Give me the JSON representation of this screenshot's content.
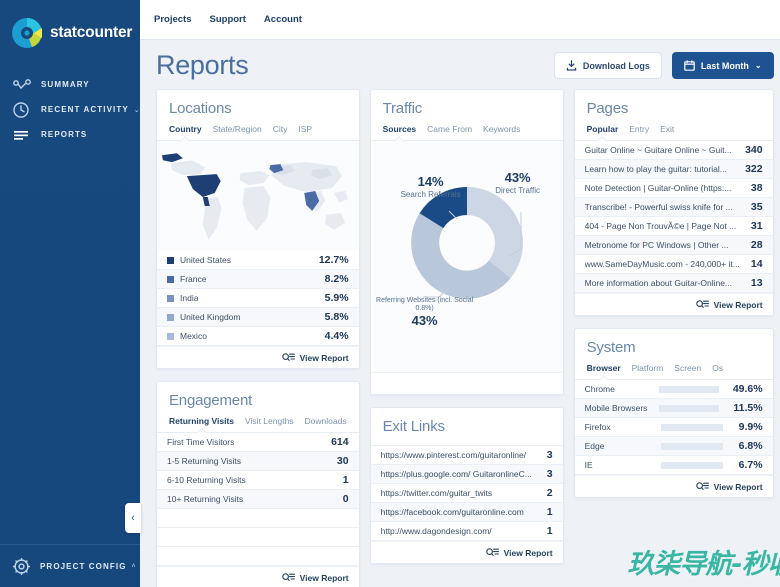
{
  "brand": {
    "name": "statcounter",
    "logo_icon": "statcounter-logo-icon"
  },
  "sidebar": {
    "items": [
      {
        "label": "SUMMARY",
        "icon": "pulse-icon",
        "caret": ""
      },
      {
        "label": "RECENT ACTIVITY",
        "icon": "clock-icon",
        "caret": "⌄"
      },
      {
        "label": "REPORTS",
        "icon": "list-icon",
        "caret": ""
      }
    ],
    "footer": {
      "label": "PROJECT CONFIG",
      "icon": "gear-icon",
      "caret": "˄"
    },
    "collapse": "‹"
  },
  "topnav": {
    "items": [
      "Projects",
      "Support",
      "Account"
    ]
  },
  "header": {
    "title": "Reports",
    "download_label": "Download Logs",
    "download_icon": "download-icon",
    "period_label": "Last Month",
    "period_icon": "calendar-icon",
    "period_caret": "⌄"
  },
  "view_report_label": "View Report",
  "locations": {
    "title": "Locations",
    "tabs": [
      "Country",
      "State/Region",
      "City",
      "ISP"
    ],
    "active_tab": "Country",
    "map_icon": "world-map-icon",
    "rows": [
      {
        "label": "United States",
        "value": "12.7%",
        "color": "#1d3f74"
      },
      {
        "label": "France",
        "value": "8.2%",
        "color": "#4a6ba5"
      },
      {
        "label": "India",
        "value": "5.9%",
        "color": "#7c93c2"
      },
      {
        "label": "United Kingdom",
        "value": "5.8%",
        "color": "#93a7cf"
      },
      {
        "label": "Mexico",
        "value": "4.4%",
        "color": "#aab9da"
      }
    ]
  },
  "engagement": {
    "title": "Engagement",
    "tabs": [
      "Returning Visits",
      "Visit Lengths",
      "Downloads"
    ],
    "active_tab": "Returning Visits",
    "rows": [
      {
        "label": "First Time Visitors",
        "value": "614"
      },
      {
        "label": "1-5 Returning Visits",
        "value": "30"
      },
      {
        "label": "6-10 Returning Visits",
        "value": "1"
      },
      {
        "label": "10+ Returning Visits",
        "value": "0"
      }
    ]
  },
  "traffic": {
    "title": "Traffic",
    "tabs": [
      "Sources",
      "Came From",
      "Keywords"
    ],
    "active_tab": "Sources"
  },
  "exit_links": {
    "title": "Exit Links",
    "rows": [
      {
        "label": "https://www.pinterest.com/guitaronline/",
        "value": "3"
      },
      {
        "label": "https://plus.google.com/ GuitaronlineC...",
        "value": "3"
      },
      {
        "label": "https://twitter.com/guitar_twits",
        "value": "2"
      },
      {
        "label": "https://facebook.com/guitaronline.com",
        "value": "1"
      },
      {
        "label": "http://www.dagondesign.com/",
        "value": "1"
      }
    ]
  },
  "pages": {
    "title": "Pages",
    "tabs": [
      "Popular",
      "Entry",
      "Exit"
    ],
    "active_tab": "Popular",
    "rows": [
      {
        "label": "Guitar Online ~ Guitare Online ~ Guit...",
        "value": "340"
      },
      {
        "label": "Learn how to play the guitar: tutorial...",
        "value": "322"
      },
      {
        "label": "Note Detection | Guitar-Online (https:...",
        "value": "38"
      },
      {
        "label": "Transcribe! - Powerful swiss knife for ...",
        "value": "35"
      },
      {
        "label": "404 - Page Non TrouvÃ©e | Page Not ...",
        "value": "31"
      },
      {
        "label": "Metronome for PC Windows | Other ...",
        "value": "28"
      },
      {
        "label": "www.SameDayMusic.com - 240,000+ it...",
        "value": "14"
      },
      {
        "label": "More information about Guitar-Online...",
        "value": "13"
      }
    ]
  },
  "system": {
    "title": "System",
    "tabs": [
      "Browser",
      "Platform",
      "Screen",
      "Os"
    ],
    "active_tab": "Browser",
    "rows": [
      {
        "label": "Chrome",
        "value": "49.6%",
        "pct": 49.6
      },
      {
        "label": "Mobile Browsers",
        "value": "11.5%",
        "pct": 11.5
      },
      {
        "label": "Firefox",
        "value": "9.9%",
        "pct": 9.9
      },
      {
        "label": "Edge",
        "value": "6.8%",
        "pct": 6.8
      },
      {
        "label": "IE",
        "value": "6.7%",
        "pct": 6.7
      }
    ]
  },
  "watermark": {
    "text": "玖柒导航-秒收"
  },
  "colors": {
    "brand_blue": "#1f5291",
    "sidebar_blue": "#17497f",
    "accent_dark": "#1d3f74",
    "donut_dark": "#1a4b87",
    "donut_mid": "#b9c7da",
    "donut_light": "#ccd6e4",
    "watermark": "#3bb6a5"
  },
  "chart_data": {
    "type": "pie",
    "title": "Traffic Sources",
    "labels": [
      "Direct Traffic",
      "Referring Websites (incl. Social 0.8%)",
      "Search Referrals"
    ],
    "values": [
      43,
      43,
      14
    ],
    "value_labels": [
      "43%",
      "43%",
      "14%"
    ],
    "colors": [
      "#ccd6e4",
      "#b9c7da",
      "#1a4b87"
    ],
    "legend": "callout-labels",
    "donut": true
  }
}
